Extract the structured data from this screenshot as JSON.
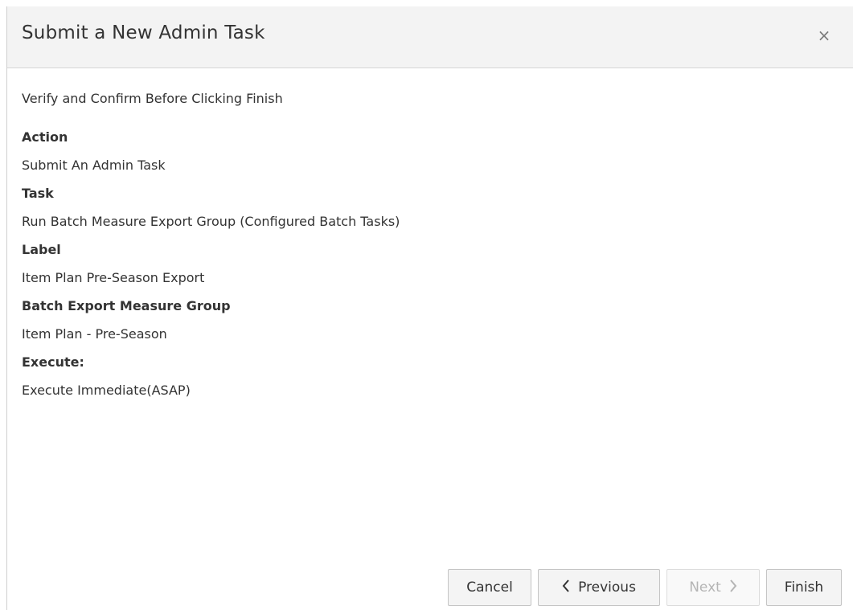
{
  "dialog": {
    "title": "Submit a New Admin Task",
    "close_glyph": "×"
  },
  "instruction": "Verify and Confirm Before Clicking Finish",
  "fields": [
    {
      "label": "Action",
      "value": "Submit An Admin Task"
    },
    {
      "label": "Task",
      "value": "Run Batch Measure Export Group (Configured Batch Tasks)"
    },
    {
      "label": "Label",
      "value": "Item Plan Pre-Season Export"
    },
    {
      "label": "Batch Export Measure Group",
      "value": "Item Plan - Pre-Season"
    },
    {
      "label": "Execute:",
      "value": "Execute Immediate(ASAP)"
    }
  ],
  "footer": {
    "cancel_label": "Cancel",
    "previous_label": "Previous",
    "next_label": "Next",
    "finish_label": "Finish",
    "next_disabled": true
  },
  "icons": {
    "close": "close-icon",
    "previous": "chevron-left-icon",
    "next": "chevron-right-icon"
  }
}
